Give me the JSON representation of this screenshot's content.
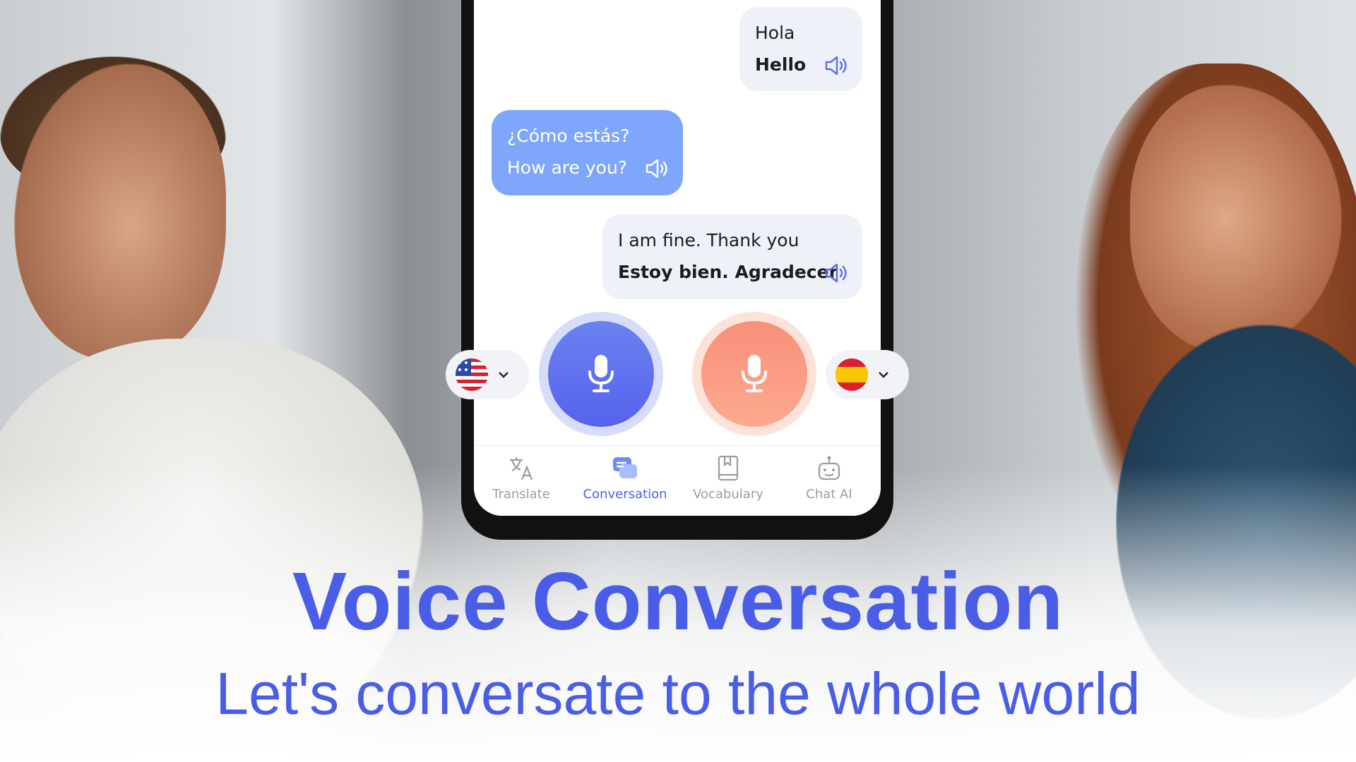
{
  "messages": [
    {
      "line1": "Hola",
      "line2": "Hello",
      "style": "grey"
    },
    {
      "line1": "¿Cómo estás?",
      "line2": "How are you?",
      "style": "blue"
    },
    {
      "line1": "I am fine. Thank you",
      "line2": "Estoy bien. Agradecer",
      "style": "grey"
    }
  ],
  "languages": {
    "left": {
      "flag": "us-flag-icon"
    },
    "right": {
      "flag": "spain-flag-icon"
    }
  },
  "mics": {
    "left_color": "#5b6ef0",
    "right_color": "#fa9e86"
  },
  "nav": [
    {
      "label": "Translate",
      "icon": "translate-icon",
      "active": false
    },
    {
      "label": "Conversation",
      "icon": "conversation-icon",
      "active": true
    },
    {
      "label": "Vocabulary",
      "icon": "vocabulary-icon",
      "active": false
    },
    {
      "label": "Chat AI",
      "icon": "robot-icon",
      "active": false
    }
  ],
  "headline": "Voice Conversation",
  "subheadline": "Let's conversate to the whole world",
  "colors": {
    "accent": "#4a5de6",
    "bubble_blue": "#7ea6fa",
    "bubble_grey": "#eef1f7"
  }
}
